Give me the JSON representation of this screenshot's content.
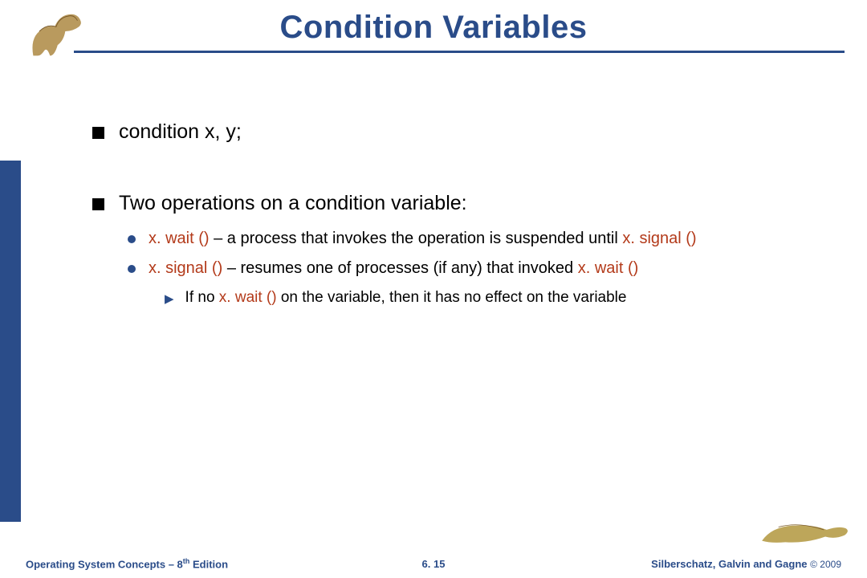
{
  "title": "Condition Variables",
  "bullets": {
    "b1": "condition x, y;",
    "b2": "Two operations on a condition variable:",
    "s1a": "x. wait () ",
    "s1b": " – a process that invokes the operation is suspended until ",
    "s1c": "x. signal ()",
    "s2a": "x. signal () ",
    "s2b": "– resumes one of processes (if any) that  invoked ",
    "s2c": "x. wait ()",
    "t1a": "If no ",
    "t1b": "x. wait () ",
    "t1c": "on the variable, then it has no effect on the variable"
  },
  "footer": {
    "left_a": "Operating System Concepts – 8",
    "left_b": " Edition",
    "th": "th",
    "center": "6. 15",
    "right_a": "Silberschatz, Galvin and Gagne ",
    "right_b": "© 2009"
  },
  "icons": {
    "dino_tl": "dinosaur-running-icon",
    "dino_br": "dinosaur-prone-icon"
  }
}
